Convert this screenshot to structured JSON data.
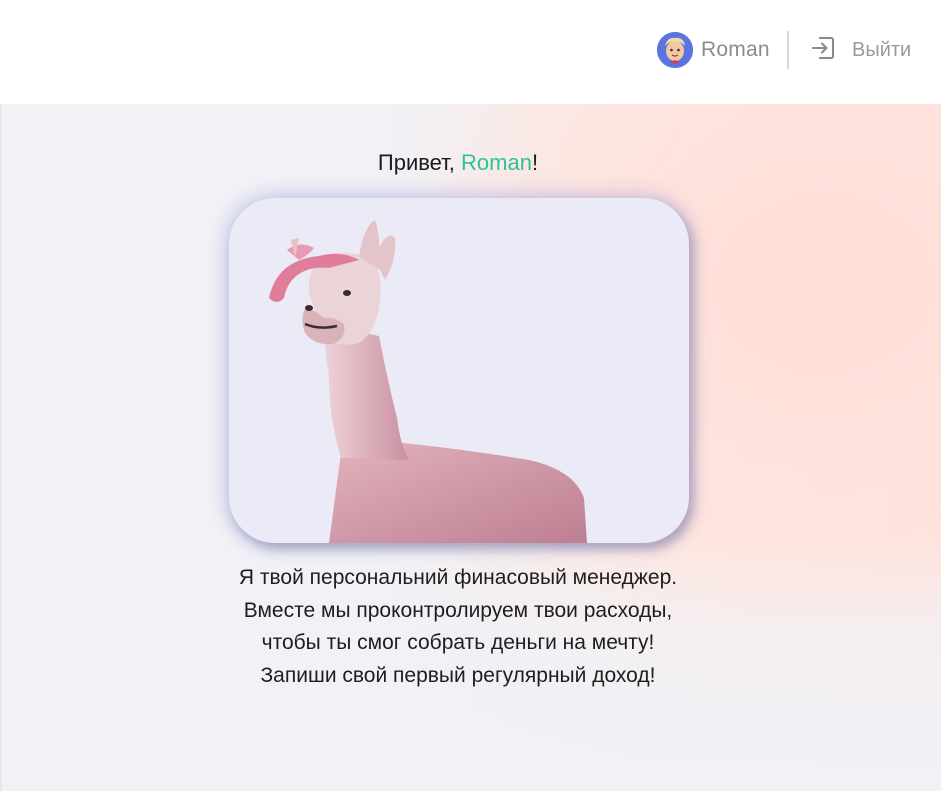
{
  "header": {
    "user_name": "Roman",
    "logout_label": "Выйти",
    "avatar_icon": "cartoon-avatar",
    "logout_icon": "logout-arrow-icon"
  },
  "main": {
    "greeting_prefix": "Привет, ",
    "greeting_name": "Roman",
    "greeting_suffix": "!",
    "image_subject": "pink-llama",
    "message_lines": [
      "Я твой персональний финасовый менеджер.",
      "Вместе мы проконтролируем твои расходы,",
      "чтобы ты смог собрать деньги на мечту!",
      "Запиши свой первый регулярный доход!"
    ]
  },
  "colors": {
    "accent": "#2ec29a",
    "muted_text": "#8c8c8c",
    "hero_left": "#f1f1f6",
    "hero_right": "#ffe3dd"
  }
}
